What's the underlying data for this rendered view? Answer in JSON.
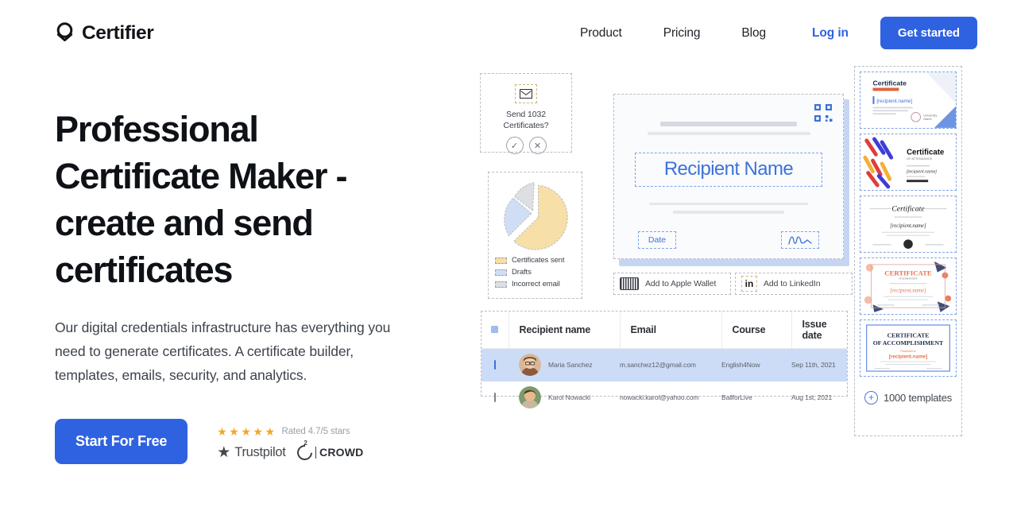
{
  "brand": {
    "name": "Certifier",
    "accent": "#2f62e0"
  },
  "nav": {
    "links": [
      {
        "label": "Product"
      },
      {
        "label": "Pricing"
      },
      {
        "label": "Blog"
      }
    ],
    "login_label": "Log in",
    "cta_label": "Get started"
  },
  "hero": {
    "headline": "Professional Certificate Maker - create and send certificates",
    "subhead": "Our digital credentials infrastructure has everything you need to generate certificates. A certificate builder, templates, emails, security, and analytics.",
    "cta_label": "Start For Free"
  },
  "ratings": {
    "stars": "★★★★★",
    "rating_text": "Rated 4.7/5 stars",
    "trustpilot_label": "Trustpilot",
    "g2_label": "CROWD",
    "g2_mark": "G2"
  },
  "illustration": {
    "send_card": {
      "line1": "Send 1032",
      "line2": "Certificates?",
      "icon": "envelope-icon",
      "confirm": "✓",
      "cancel": "✕"
    },
    "pie_card": {
      "legend": [
        {
          "label": "Certificates sent",
          "color": "#f7dfa8",
          "value": 65
        },
        {
          "label": "Drafts",
          "color": "#cfdef5",
          "value": 22
        },
        {
          "label": "Incorrect email",
          "color": "#dddfe2",
          "value": 13
        }
      ]
    },
    "certificate": {
      "recipient_placeholder": "Recipient Name",
      "date_label": "Date",
      "qr_label": "qr-code"
    },
    "wallet_buttons": [
      {
        "label": "Add to Apple Wallet",
        "icon": "apple-wallet-icon"
      },
      {
        "label": "Add to LinkedIn",
        "icon": "linkedin-icon"
      }
    ],
    "table": {
      "columns": [
        "Recipient name",
        "Email",
        "Course",
        "Issue date"
      ],
      "rows": [
        {
          "selected": true,
          "name": "Maria Sanchez",
          "email": "m.sanchez12@gmail.com",
          "course": "English4Now",
          "date": "Sep 11th, 2021"
        },
        {
          "selected": false,
          "name": "Karol Nowacki",
          "email": "nowacki.karol@yahoo.com",
          "course": "BallforLive",
          "date": "Aug 1st, 2021"
        }
      ]
    },
    "templates": {
      "more_label": "1000 templates",
      "items": [
        {
          "title": "Certificate",
          "recipient": "[recipient.name]"
        },
        {
          "title": "Certificate",
          "recipient": "[recipient.name]"
        },
        {
          "title": "Certificate",
          "recipient": "[recipient.name]"
        },
        {
          "title": "CERTIFICATE",
          "recipient": "[recipient.name]"
        },
        {
          "title": "CERTIFICATE OF ACCOMPLISHMENT",
          "recipient": "[recipient.name]"
        }
      ]
    }
  }
}
